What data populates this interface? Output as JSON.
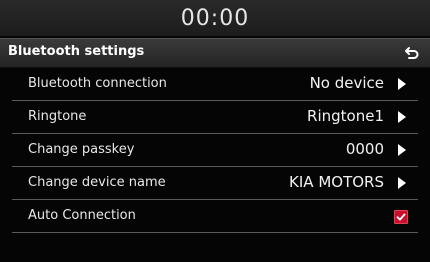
{
  "status_bar": {
    "time": "00:00"
  },
  "header": {
    "title": "Bluetooth settings",
    "back_icon": "back-arrow-icon"
  },
  "rows": [
    {
      "label": "Bluetooth connection",
      "value": "No device",
      "control": "arrow"
    },
    {
      "label": "Ringtone",
      "value": "Ringtone1",
      "control": "arrow"
    },
    {
      "label": "Change passkey",
      "value": "0000",
      "control": "arrow"
    },
    {
      "label": "Change device name",
      "value": "KIA MOTORS",
      "control": "arrow"
    },
    {
      "label": "Auto Connection",
      "value": "",
      "control": "checkbox",
      "checked": true
    }
  ],
  "colors": {
    "accent": "#c8102e",
    "background": "#050505",
    "text": "#e8e8e8"
  }
}
